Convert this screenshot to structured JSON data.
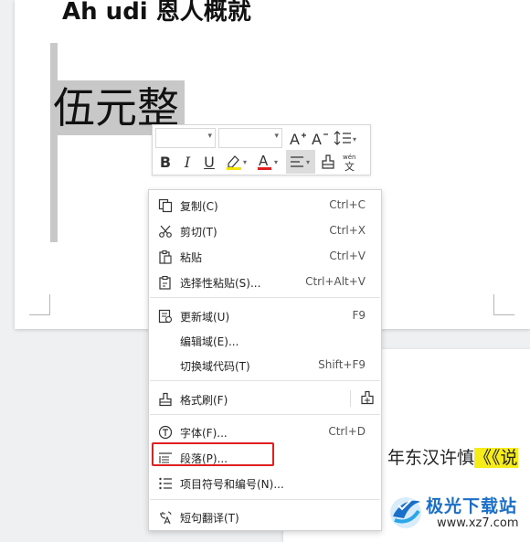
{
  "document": {
    "heading": "Ah udi 恩人概就",
    "selected_text": "伍元整",
    "page2_prefix": "年东汉许慎",
    "page2_highlight": "《《说"
  },
  "mini_toolbar": {
    "font_name": "",
    "font_size": "",
    "buttons": {
      "grow_font": "A⁺",
      "shrink_font": "A⁻",
      "line_spacing": "↕",
      "bold": "B",
      "italic": "I",
      "underline": "U",
      "highlight": "ab",
      "font_color": "A",
      "align": "≡",
      "format_painter": "⌂",
      "phonetic": "wén"
    },
    "colors": {
      "highlight": "#f5e400",
      "font_color": "#e02020"
    }
  },
  "context_menu": {
    "items": [
      {
        "label": "复制(C)",
        "shortcut": "Ctrl+C",
        "icon": "copy-icon"
      },
      {
        "label": "剪切(T)",
        "shortcut": "Ctrl+X",
        "icon": "scissors-icon"
      },
      {
        "label": "粘贴",
        "shortcut": "Ctrl+V",
        "icon": "paste-icon"
      },
      {
        "label": "选择性粘贴(S)...",
        "shortcut": "Ctrl+Alt+V",
        "icon": "paste-special-icon"
      },
      {
        "label": "更新域(U)",
        "shortcut": "F9",
        "icon": "update-field-icon"
      },
      {
        "label": "编辑域(E)...",
        "shortcut": "",
        "icon": ""
      },
      {
        "label": "切换域代码(T)",
        "shortcut": "Shift+F9",
        "icon": ""
      },
      {
        "label": "格式刷(F)",
        "shortcut": "",
        "icon": "format-painter-icon"
      },
      {
        "label": "字体(F)...",
        "shortcut": "Ctrl+D",
        "icon": "font-icon"
      },
      {
        "label": "段落(P)...",
        "shortcut": "",
        "icon": "paragraph-icon"
      },
      {
        "label": "项目符号和编号(N)...",
        "shortcut": "",
        "icon": "bullets-icon"
      },
      {
        "label": "短句翻译(T)",
        "shortcut": "",
        "icon": "translate-icon"
      }
    ],
    "highlighted_item": "段落(P)..."
  },
  "watermark": {
    "title": "极光下载站",
    "url": "www.xz7.com"
  }
}
